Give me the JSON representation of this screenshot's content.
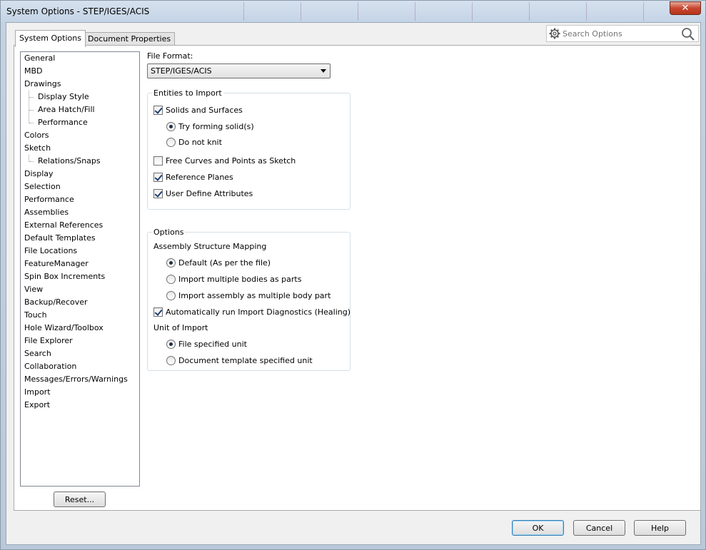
{
  "window": {
    "title": "System Options - STEP/IGES/ACIS",
    "close_label": "✕"
  },
  "tabs": [
    {
      "label": "System Options"
    },
    {
      "label": "Document Properties"
    }
  ],
  "search": {
    "placeholder": "Search Options"
  },
  "tree": {
    "items": [
      {
        "label": "General",
        "level": 0
      },
      {
        "label": "MBD",
        "level": 0
      },
      {
        "label": "Drawings",
        "level": 0
      },
      {
        "label": "Display Style",
        "level": 1
      },
      {
        "label": "Area Hatch/Fill",
        "level": 1
      },
      {
        "label": "Performance",
        "level": 1
      },
      {
        "label": "Colors",
        "level": 0
      },
      {
        "label": "Sketch",
        "level": 0
      },
      {
        "label": "Relations/Snaps",
        "level": 1
      },
      {
        "label": "Display",
        "level": 0
      },
      {
        "label": "Selection",
        "level": 0
      },
      {
        "label": "Performance",
        "level": 0
      },
      {
        "label": "Assemblies",
        "level": 0
      },
      {
        "label": "External References",
        "level": 0
      },
      {
        "label": "Default Templates",
        "level": 0
      },
      {
        "label": "File Locations",
        "level": 0
      },
      {
        "label": "FeatureManager",
        "level": 0
      },
      {
        "label": "Spin Box Increments",
        "level": 0
      },
      {
        "label": "View",
        "level": 0
      },
      {
        "label": "Backup/Recover",
        "level": 0
      },
      {
        "label": "Touch",
        "level": 0
      },
      {
        "label": "Hole Wizard/Toolbox",
        "level": 0
      },
      {
        "label": "File Explorer",
        "level": 0
      },
      {
        "label": "Search",
        "level": 0
      },
      {
        "label": "Collaboration",
        "level": 0
      },
      {
        "label": "Messages/Errors/Warnings",
        "level": 0
      },
      {
        "label": "Import",
        "level": 0
      },
      {
        "label": "Export",
        "level": 0
      }
    ],
    "reset_label": "Reset..."
  },
  "file_format": {
    "label": "File Format:",
    "value": "STEP/IGES/ACIS"
  },
  "entities": {
    "title": "Entities to Import",
    "solids_surfaces": {
      "label": "Solids and Surfaces",
      "checked": true
    },
    "try_forming": {
      "label": "Try forming solid(s)",
      "selected": true
    },
    "do_not_knit": {
      "label": "Do not knit",
      "selected": false
    },
    "free_curves": {
      "label": "Free Curves and Points as Sketch",
      "checked": false
    },
    "reference_planes": {
      "label": "Reference Planes",
      "checked": true
    },
    "user_define_attributes": {
      "label": "User Define Attributes",
      "checked": true
    }
  },
  "options": {
    "title": "Options",
    "asm_mapping_label": "Assembly Structure Mapping",
    "default_mapping": {
      "label": "Default (As per the file)",
      "selected": true
    },
    "multiple_bodies_parts": {
      "label": "Import multiple bodies as parts",
      "selected": false
    },
    "assembly_multibody": {
      "label": "Import assembly as multiple body part",
      "selected": false
    },
    "auto_diagnostics": {
      "label": "Automatically run Import Diagnostics (Healing)",
      "checked": true
    },
    "unit_label": "Unit of Import",
    "file_unit": {
      "label": "File specified unit",
      "selected": true
    },
    "template_unit": {
      "label": "Document template specified unit",
      "selected": false
    }
  },
  "buttons": {
    "ok": "OK",
    "cancel": "Cancel",
    "help": "Help"
  }
}
